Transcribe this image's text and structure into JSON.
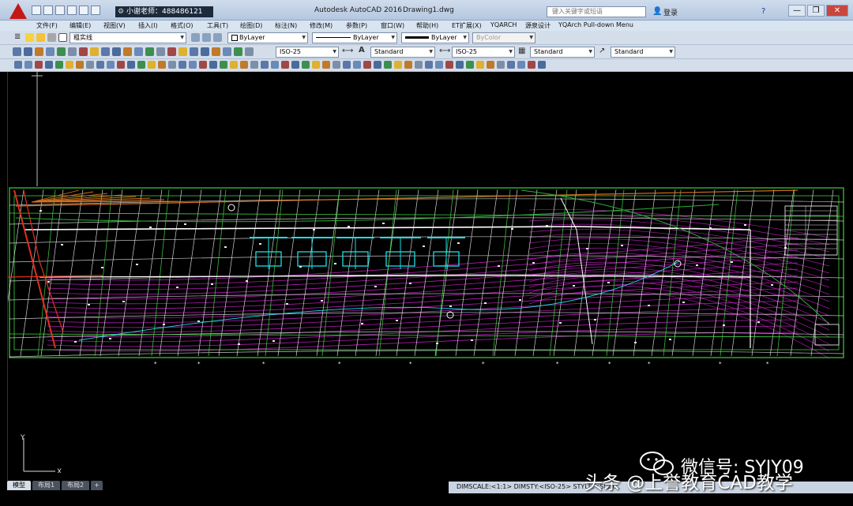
{
  "titlebar": {
    "workspace": "小谢老师：488486121",
    "app_title": "Autodesk AutoCAD 2016",
    "document": "Drawing1.dwg",
    "search_placeholder": "键入关键字或短语",
    "signin": "登录",
    "help": "?"
  },
  "menubar": {
    "items": [
      "文件(F)",
      "编辑(E)",
      "视图(V)",
      "插入(I)",
      "格式(O)",
      "工具(T)",
      "绘图(D)",
      "标注(N)",
      "修改(M)",
      "参数(P)",
      "窗口(W)",
      "帮助(H)",
      "ET扩展(X)",
      "YQARCH",
      "源泉设计",
      "YQArch Pull-down Menu"
    ]
  },
  "toolbar_properties": {
    "layer": "粗实线",
    "color": "ByLayer",
    "linetype": "ByLayer",
    "lineweight": "ByLayer",
    "plotstyle": "ByColor"
  },
  "toolbar_styles": {
    "dimstyle": "ISO-25",
    "textstyle": "Standard",
    "dimstyle2": "ISO-25",
    "tablestyle": "Standard",
    "mleaderstyle": "Standard"
  },
  "layout_tabs": {
    "model": "模型",
    "layout1": "布局1",
    "layout2": "布局2",
    "add": "+"
  },
  "statusbar": {
    "text": "DIMSCALE:<1:1> DIMSTY:<ISO-25> STYLE:<Stan..."
  },
  "ucs": {
    "y": "Y",
    "x": "X"
  },
  "watermark": {
    "line1": "微信号: SYJY09",
    "line2": "头条 @上誉教育CAD教学"
  },
  "colors": {
    "grid_green": "#3fcf3f",
    "grid_white": "#e8e8e8",
    "magenta": "#d020d0",
    "cyan": "#19e0e6",
    "red": "#e03020",
    "orange": "#d2701e"
  }
}
